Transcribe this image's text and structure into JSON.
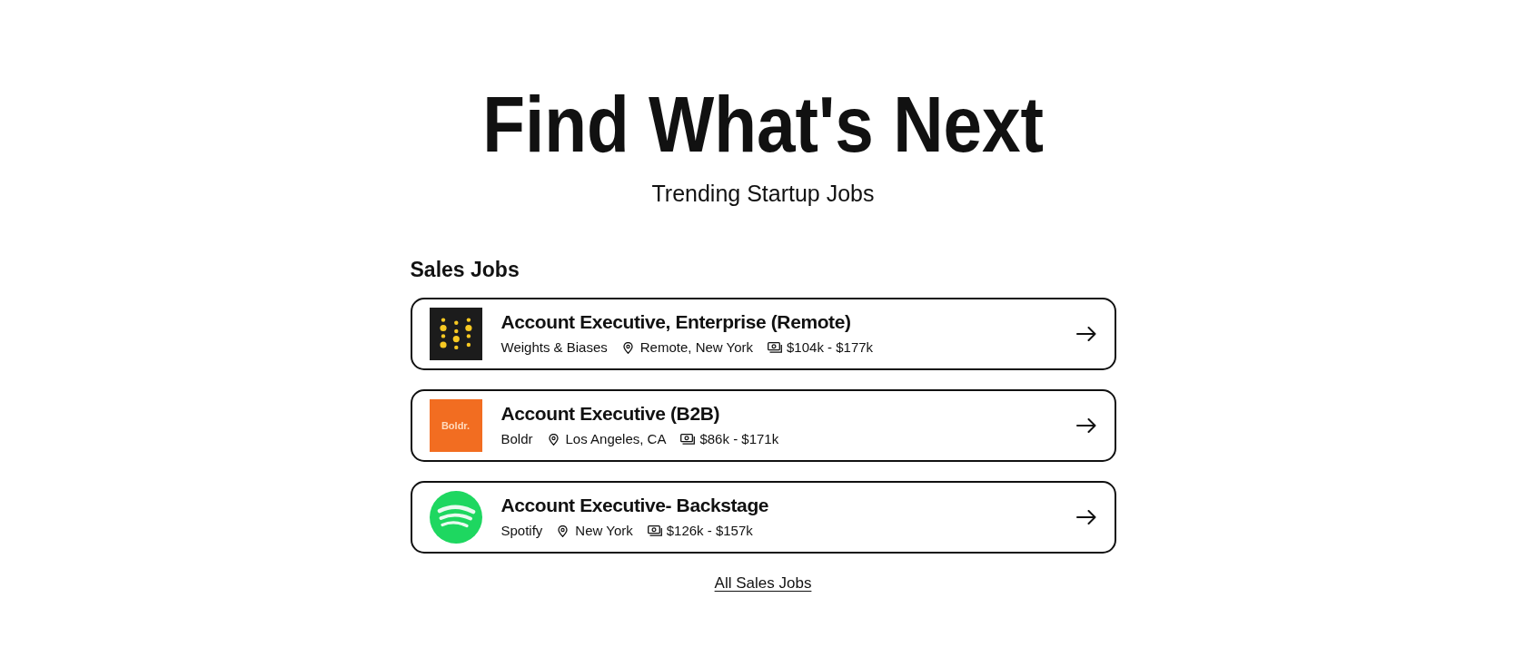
{
  "hero": {
    "title": "Find What's Next",
    "subtitle": "Trending Startup Jobs"
  },
  "section": {
    "heading": "Sales Jobs",
    "jobs": [
      {
        "title": "Account Executive, Enterprise (Remote)",
        "company": "Weights & Biases",
        "location": "Remote, New York",
        "salary": "$104k - $177k",
        "logo": {
          "kind": "dots"
        }
      },
      {
        "title": "Account Executive (B2B)",
        "company": "Boldr",
        "location": "Los Angeles, CA",
        "salary": "$86k - $171k",
        "logo": {
          "kind": "wordmark",
          "text": "Boldr."
        }
      },
      {
        "title": "Account Executive- Backstage",
        "company": "Spotify",
        "location": "New York",
        "salary": "$126k - $157k",
        "logo": {
          "kind": "waves"
        }
      }
    ],
    "link": "All Sales Jobs"
  }
}
